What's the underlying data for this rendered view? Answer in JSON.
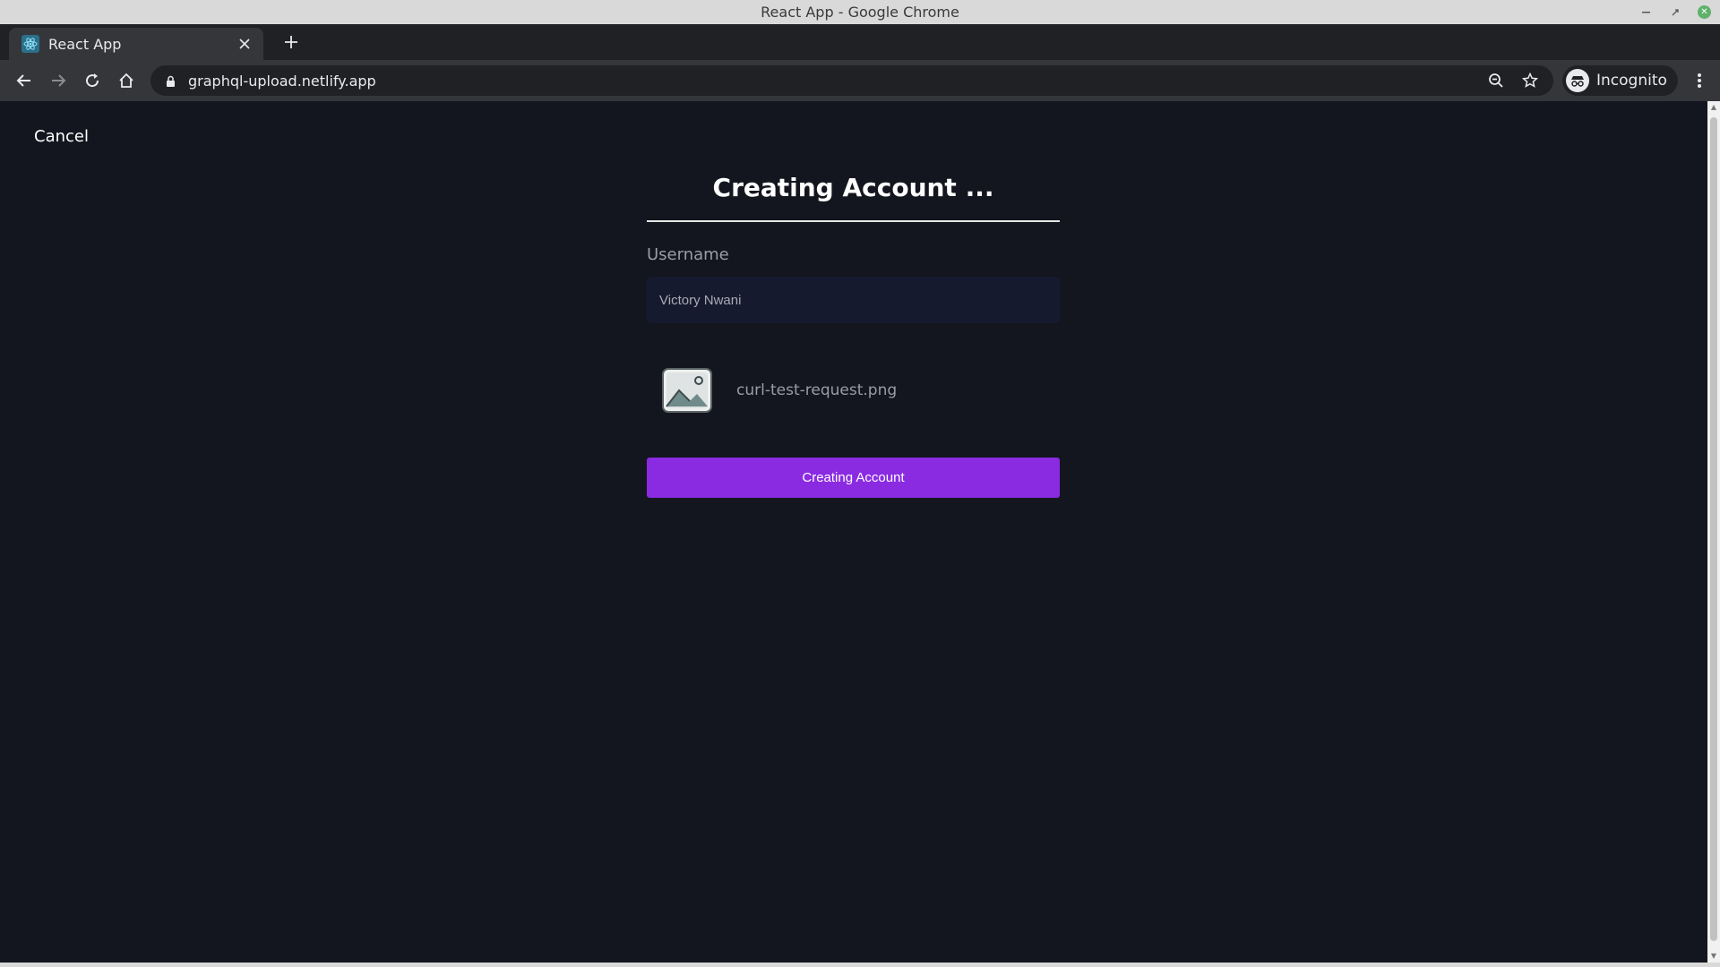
{
  "window": {
    "title": "React App - Google Chrome"
  },
  "tabs": [
    {
      "title": "React App",
      "active": true
    }
  ],
  "toolbar": {
    "url": "graphql-upload.netlify.app",
    "profile_label": "Incognito"
  },
  "page": {
    "cancel_label": "Cancel",
    "heading": "Creating Account ...",
    "username_label": "Username",
    "username_value": "Victory Nwani",
    "file_name": "curl-test-request.png",
    "submit_label": "Creating Account"
  },
  "colors": {
    "page_background": "#14161f",
    "button_accent": "#8a2be2",
    "input_background": "#151a2e"
  },
  "icons": {
    "back": "arrow-left-icon",
    "forward": "arrow-right-icon",
    "reload": "reload-icon",
    "home": "home-icon",
    "lock": "lock-icon",
    "zoom": "zoom-icon",
    "bookmark": "star-icon",
    "incognito": "incognito-icon",
    "menu": "kebab-menu-icon",
    "file_preview": "image-icon"
  }
}
